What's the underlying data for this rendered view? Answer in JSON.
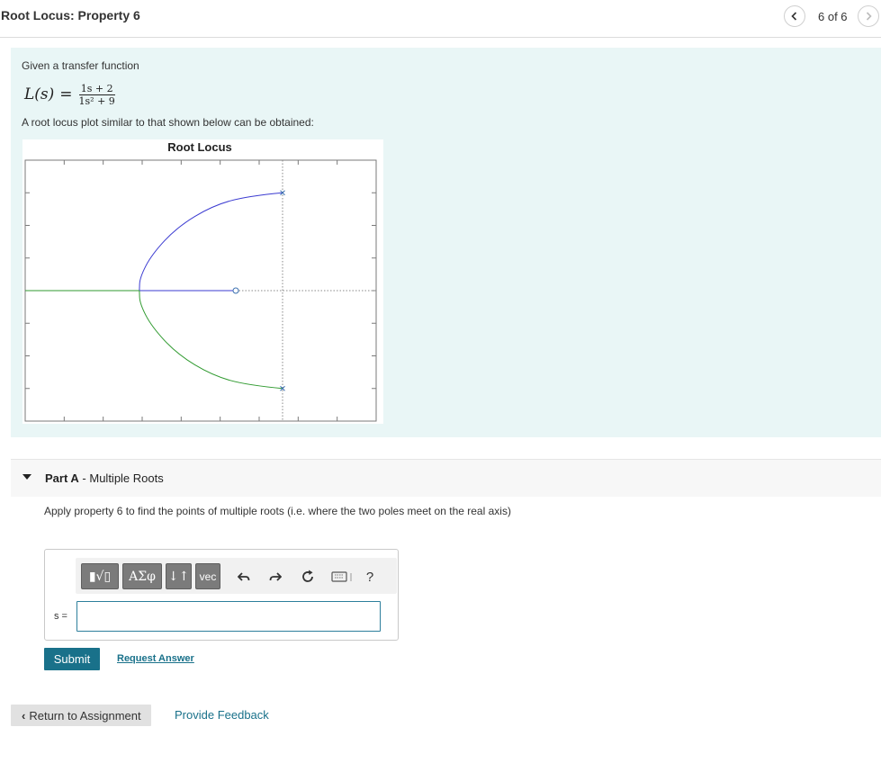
{
  "header": {
    "title": "Root Locus: Property 6",
    "counter": "6 of 6"
  },
  "intro": {
    "given_text": "Given a transfer function",
    "formula": {
      "lhs": "L(s)",
      "eq": "=",
      "numerator": "1s + 2",
      "denominator": "1s² + 9"
    },
    "plot_text": "A root locus plot similar to that shown below can be obtained:"
  },
  "chart_data": {
    "type": "line",
    "title": "Root Locus",
    "xlabel": "",
    "ylabel": "",
    "tick_labels_shown": false,
    "grid": false,
    "xlim": [
      -11,
      4
    ],
    "ylim": [
      -4,
      4
    ],
    "poles": [
      [
        0,
        3
      ],
      [
        0,
        -3
      ]
    ],
    "zeros": [
      [
        -2,
        0
      ]
    ],
    "asymptote_x": 0,
    "series": [
      {
        "color": "#3b3bd1",
        "points": [
          [
            0,
            3
          ],
          [
            -1.5,
            2.9
          ],
          [
            -3,
            2.6
          ],
          [
            -4.5,
            1.95
          ],
          [
            -5.6,
            1.1
          ],
          [
            -6.1,
            0.4
          ],
          [
            -6.12,
            0
          ]
        ]
      },
      {
        "color": "#3b3bd1",
        "points": [
          [
            -6.12,
            0
          ],
          [
            -2,
            0
          ]
        ]
      },
      {
        "color": "#2f9a2f",
        "points": [
          [
            0,
            -3
          ],
          [
            -1.5,
            -2.9
          ],
          [
            -3,
            -2.6
          ],
          [
            -4.5,
            -1.95
          ],
          [
            -5.6,
            -1.1
          ],
          [
            -6.1,
            -0.4
          ],
          [
            -6.12,
            0
          ]
        ]
      },
      {
        "color": "#2f9a2f",
        "points": [
          [
            -6.12,
            0
          ],
          [
            -11,
            0
          ]
        ]
      }
    ]
  },
  "partA": {
    "label_bold": "Part A",
    "label_rest": " - Multiple Roots",
    "question": "Apply property 6 to find the points of multiple roots (i.e. where the two poles meet on the real axis)"
  },
  "answer": {
    "toolbar": {
      "templates_label": "▮√▯",
      "greek_label": "ΑΣφ",
      "arrows_label": "↓↑",
      "vec_label": "vec",
      "help_label": "?"
    },
    "variable_label": "s =",
    "input_value": ""
  },
  "actions": {
    "submit_label": "Submit",
    "request_answer_label": "Request Answer"
  },
  "footer": {
    "return_label": "Return to Assignment",
    "feedback_label": "Provide Feedback"
  },
  "colors": {
    "accent": "#19718a",
    "panel_bg": "#e9f6f6",
    "branch_blue": "#3b3bd1",
    "branch_green": "#2f9a2f"
  }
}
